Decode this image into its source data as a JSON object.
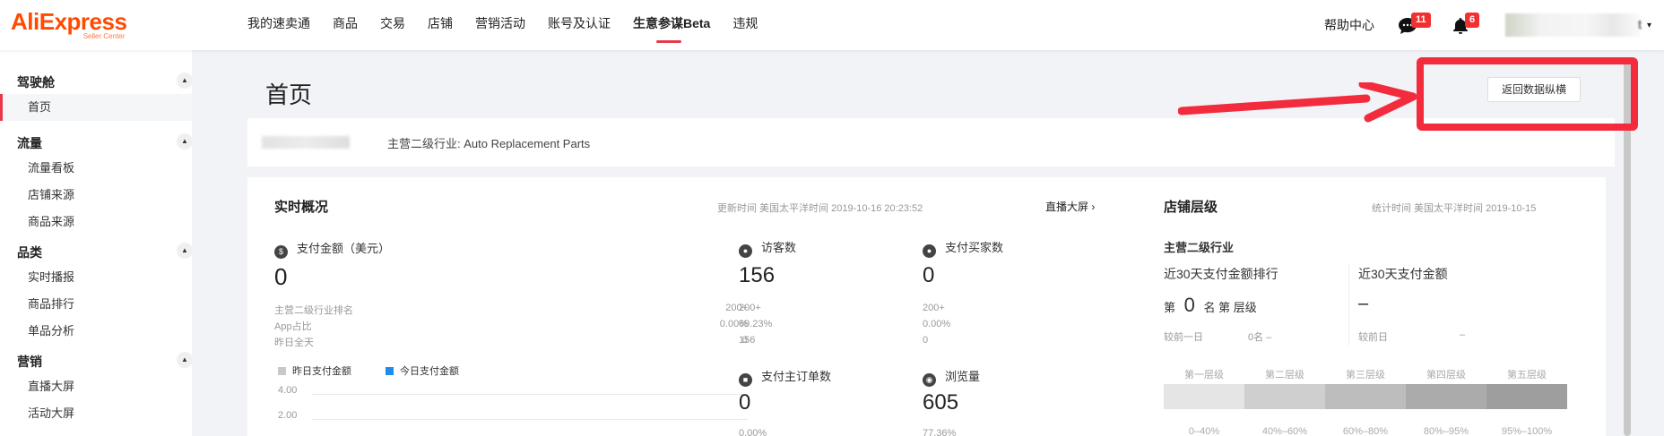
{
  "brand": {
    "name": "AliExpress",
    "sub": "Seller Center"
  },
  "nav": [
    "我的速卖通",
    "商品",
    "交易",
    "店铺",
    "营销活动",
    "账号及认证",
    "生意参谋Beta",
    "违规"
  ],
  "nav_active_index": 6,
  "top_right": {
    "help": "帮助中心",
    "messages_count": "11",
    "notifications_count": "6",
    "user_suffix": "t",
    "caret": "▾"
  },
  "sidebar": {
    "groups": [
      {
        "title": "驾驶舱",
        "items": [
          "首页"
        ]
      },
      {
        "title": "流量",
        "items": [
          "流量看板",
          "店铺来源",
          "商品来源"
        ]
      },
      {
        "title": "品类",
        "items": [
          "实时播报",
          "商品排行",
          "单品分析"
        ]
      },
      {
        "title": "营销",
        "items": [
          "直播大屏",
          "活动大屏"
        ]
      }
    ],
    "active_item": "首页",
    "collapse_glyph": "▲"
  },
  "main": {
    "page_title": "首页",
    "back_button": "返回数据纵横",
    "industry_label": "主营二级行业: Auto Replacement Parts"
  },
  "realtime": {
    "title": "实时概况",
    "update_time": "更新时间 美国太平洋时间 2019-10-16 20:23:52",
    "live_link": "直播大屏 ›",
    "payment": {
      "label": "支付金额（美元）",
      "value": "0",
      "rows": [
        {
          "k": "主营二级行业排名",
          "v": "200+"
        },
        {
          "k": "App占比",
          "v": "0.00%"
        },
        {
          "k": "昨日全天",
          "v": "0"
        }
      ]
    },
    "visitors": {
      "label": "访客数",
      "value": "156",
      "rows": [
        "200+",
        "69.23%",
        "156"
      ]
    },
    "buyers": {
      "label": "支付买家数",
      "value": "0",
      "rows": [
        "200+",
        "0.00%",
        "0"
      ]
    },
    "orders": {
      "label": "支付主订单数",
      "value": "0",
      "rows": [
        "0.00%"
      ]
    },
    "views": {
      "label": "浏览量",
      "value": "605",
      "rows": [
        "77.36%"
      ]
    },
    "chart_legend": [
      {
        "name": "昨日支付金额",
        "color": "#c8c8c8"
      },
      {
        "name": "今日支付金额",
        "color": "#1f8ceb"
      }
    ],
    "chart_ticks": [
      "4.00",
      "2.00"
    ]
  },
  "level": {
    "title": "店铺层级",
    "stat_time": "统计时间 美国太平洋时间 2019-10-15",
    "industry_title": "主营二级行业",
    "rank_title": "近30天支付金额排行",
    "rank_prefix": "第",
    "rank_value": "0",
    "rank_suffix": "名 第 层级",
    "rank_compare_k": "较前一日",
    "rank_compare_v": "0名 –",
    "amount_title": "近30天支付金额",
    "amount_value": "–",
    "amount_compare_k": "较前日",
    "amount_compare_v": "–",
    "levels": [
      {
        "name": "第一层级",
        "range": "0–40%",
        "color": "#e5e5e5"
      },
      {
        "name": "第二层级",
        "range": "40%–60%",
        "color": "#cfcfcf"
      },
      {
        "name": "第三层级",
        "range": "60%–80%",
        "color": "#bdbdbd"
      },
      {
        "name": "第四层级",
        "range": "80%–95%",
        "color": "#ababab"
      },
      {
        "name": "第五层级",
        "range": "95%–100%",
        "color": "#9e9e9e"
      }
    ]
  },
  "colors": {
    "accent": "#e8394a",
    "brand": "#ff4a00",
    "annotation": "#f22c3d"
  }
}
